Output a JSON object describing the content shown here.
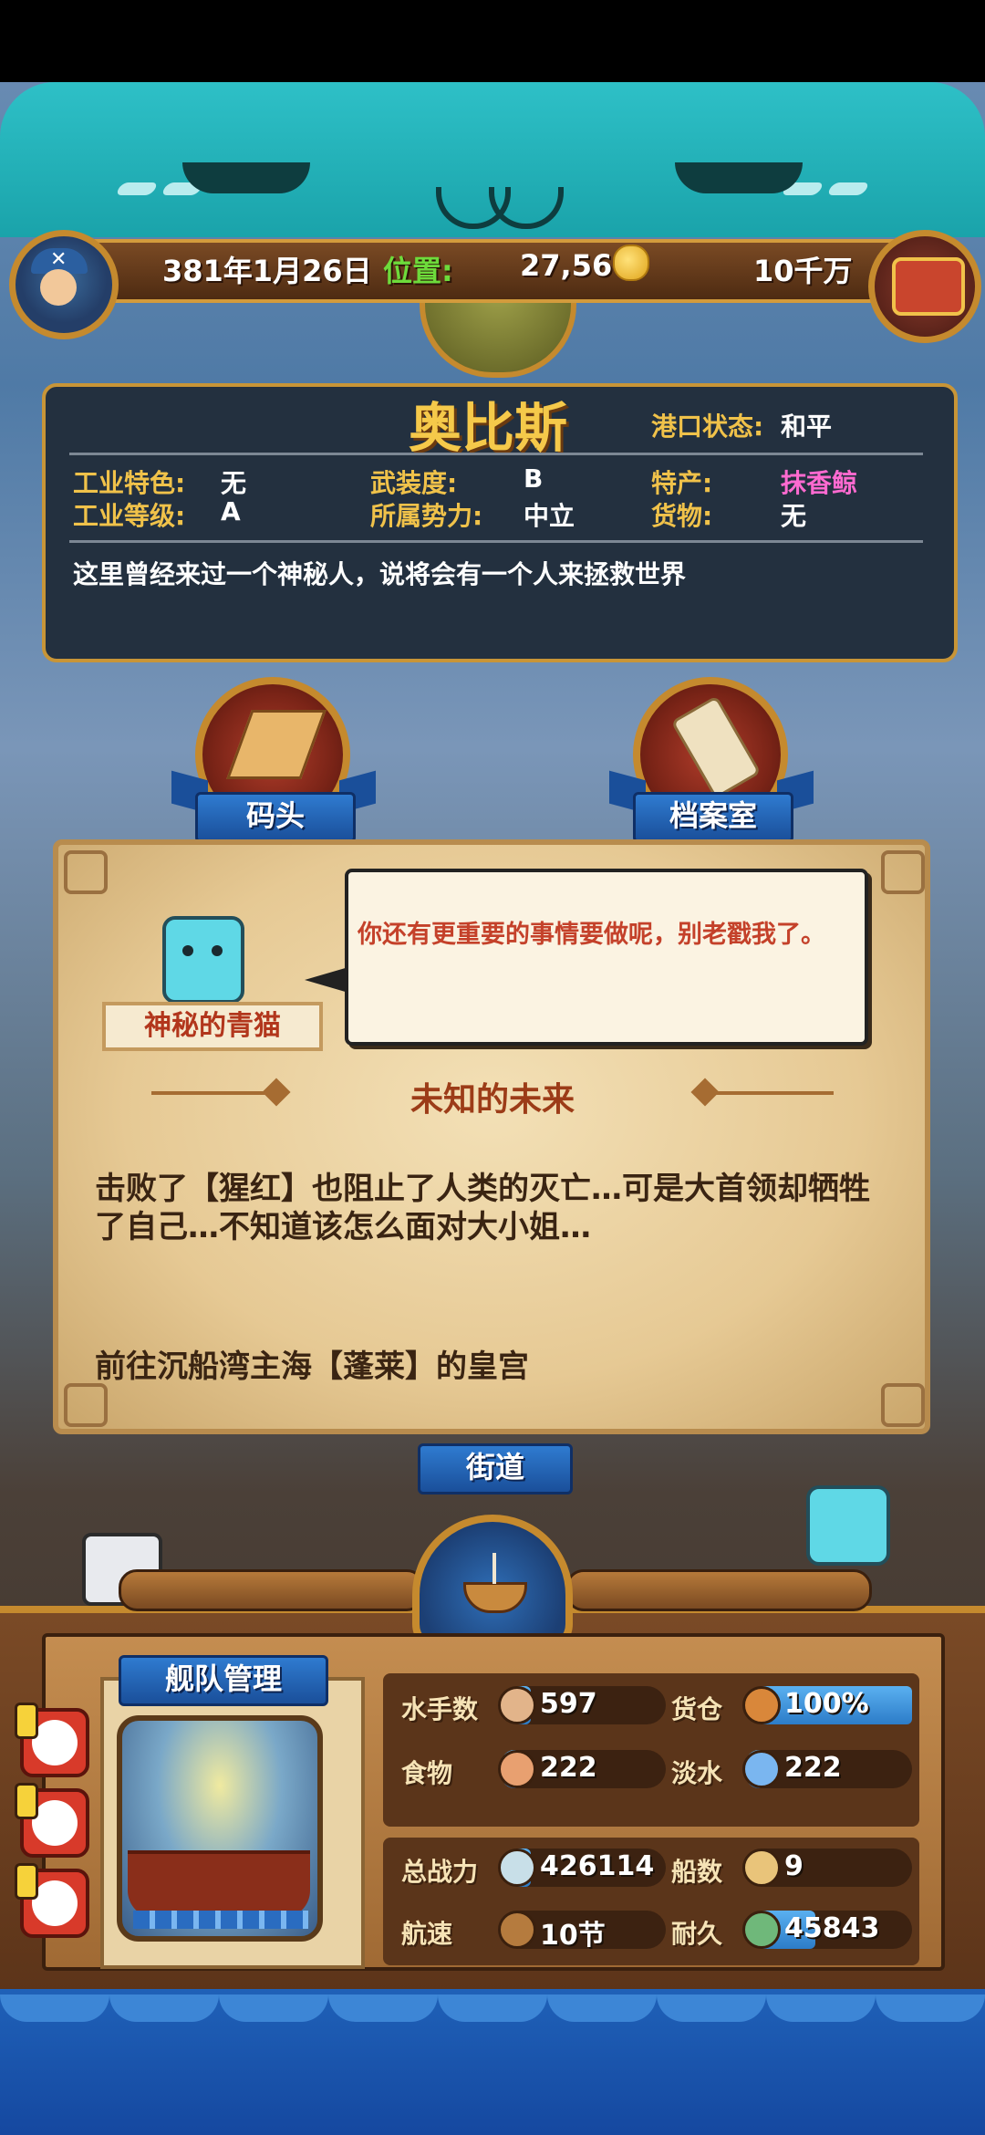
{
  "status_bar": {
    "date": "381年1月26日",
    "location_label": "位置:",
    "coordinates": "27,56",
    "money": "10千万"
  },
  "port": {
    "name": "奥比斯",
    "state_label": "港口状态:",
    "state_value": "和平",
    "industry_feature_label": "工业特色:",
    "industry_feature_value": "无",
    "armament_label": "武装度:",
    "armament_value": "B",
    "specialty_label": "特产:",
    "specialty_value": "抹香鲸",
    "industry_level_label": "工业等级:",
    "industry_level_value": "A",
    "faction_label": "所属势力:",
    "faction_value": "中立",
    "cargo_label": "货物:",
    "cargo_value": "无",
    "description": "这里曾经来过一个神秘人，说将会有一个人来拯救世界"
  },
  "locations": {
    "dock": "码头",
    "archive": "档案室",
    "street": "街道"
  },
  "dialog": {
    "speaker": "神秘的青猫",
    "speech": "你还有更重要的事情要做呢，别老戳我了。",
    "title": "未知的未来",
    "story": "击败了【猩红】也阻止了人类的灭亡…可是大首领却牺牲了自己…不知道该怎么面对大小姐…",
    "objective": "前往沉船湾主海【蓬莱】的皇宫"
  },
  "fleet": {
    "title": "舰队管理",
    "stats": [
      {
        "label": "水手数",
        "value": "597",
        "fill": 0.18,
        "icon": "sailor-icon"
      },
      {
        "label": "货仓",
        "value": "100%",
        "fill": 1.0,
        "icon": "cargo-crate-icon"
      },
      {
        "label": "食物",
        "value": "222",
        "fill": 0.1,
        "icon": "meat-icon"
      },
      {
        "label": "淡水",
        "value": "222",
        "fill": 0.1,
        "icon": "water-jug-icon"
      },
      {
        "label": "总战力",
        "value": "426114",
        "fill": 0.18,
        "icon": "crossed-swords-icon"
      },
      {
        "label": "船数",
        "value": "9",
        "fill": 0.0,
        "icon": "sail-icon"
      },
      {
        "label": "航速",
        "value": "10节",
        "fill": 0.0,
        "icon": "ship-speed-icon"
      },
      {
        "label": "耐久",
        "value": "45843",
        "fill": 0.42,
        "icon": "ship-durability-icon"
      }
    ]
  },
  "colors": {
    "accent_gold": "#f5c94a",
    "location_green": "#6ddb3b",
    "specialty_pink": "#ff6ad0",
    "speech_red": "#c4412a"
  }
}
